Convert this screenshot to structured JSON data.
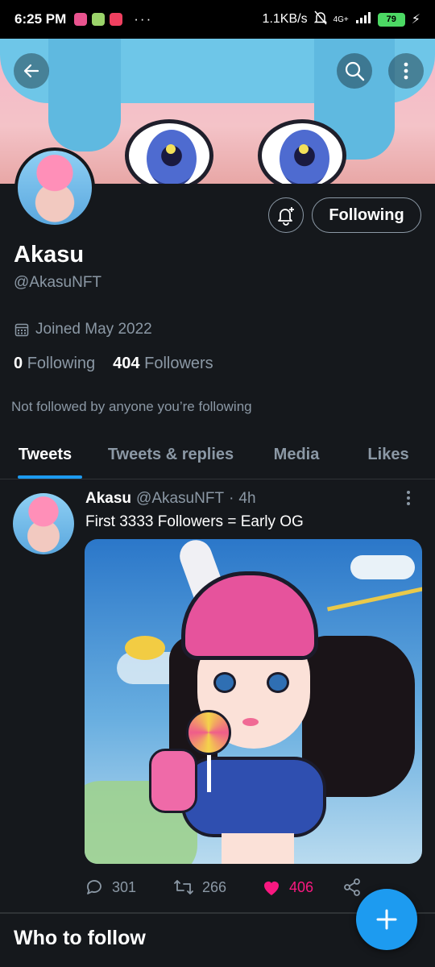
{
  "status_bar": {
    "time": "6:25 PM",
    "more_dots": "···",
    "net_speed": "1.1KB/s",
    "network": "4G+",
    "battery": "79"
  },
  "header": {
    "back_icon": "arrow-left-icon",
    "search_icon": "search-icon",
    "more_icon": "more-vertical-icon"
  },
  "profile": {
    "name": "Akasu",
    "handle": "@AkasuNFT",
    "joined": "Joined May 2022",
    "following_count": "0",
    "following_label": "Following",
    "followers_count": "404",
    "followers_label": "Followers",
    "not_followed_text": "Not followed by anyone you’re following",
    "follow_button_label": "Following"
  },
  "tabs": [
    {
      "label": "Tweets",
      "active": true
    },
    {
      "label": "Tweets & replies",
      "active": false
    },
    {
      "label": "Media",
      "active": false
    },
    {
      "label": "Likes",
      "active": false
    }
  ],
  "tweet": {
    "author_name": "Akasu",
    "author_handle": "@AkasuNFT",
    "separator": "·",
    "time": "4h",
    "text": "First 3333 Followers = Early OG",
    "replies": "301",
    "retweets": "266",
    "likes": "406",
    "liked": true
  },
  "who_to_follow": {
    "title": "Who to follow"
  },
  "colors": {
    "accent": "#1d9bf0",
    "like": "#f91880",
    "background": "#15181c",
    "secondary_text": "#8b98a5"
  }
}
